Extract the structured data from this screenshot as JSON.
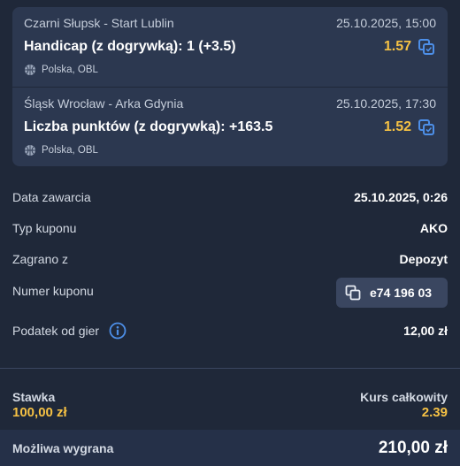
{
  "bets": [
    {
      "match": "Czarni Słupsk - Start Lublin",
      "datetime": "25.10.2025, 15:00",
      "market": "Handicap (z dogrywką): 1 (+3.5)",
      "odd": "1.57",
      "league": "Polska, OBL"
    },
    {
      "match": "Śląsk Wrocław - Arka Gdynia",
      "datetime": "25.10.2025, 17:30",
      "market": "Liczba punktów (z dogrywką): +163.5",
      "odd": "1.52",
      "league": "Polska, OBL"
    }
  ],
  "details": {
    "date_label": "Data zawarcia",
    "date_value": "25.10.2025, 0:26",
    "type_label": "Typ kuponu",
    "type_value": "AKO",
    "played_label": "Zagrano z",
    "played_value": "Depozyt",
    "coupon_label": "Numer kuponu",
    "coupon_value": "e74 196 03",
    "tax_label": "Podatek od gier",
    "tax_value": "12,00 zł"
  },
  "summary": {
    "stake_label": "Stawka",
    "stake_value": "100,00 zł",
    "total_odds_label": "Kurs całkowity",
    "total_odds_value": "2.39",
    "possible_win_label": "Możliwa wygrana",
    "possible_win_value": "210,00 zł"
  },
  "icons": {
    "copy": "copy-icon",
    "basketball": "basketball-icon",
    "info": "info-icon"
  },
  "colors": {
    "background": "#1f2839",
    "card": "#2c3850",
    "odds_accent": "#f5c144",
    "icon_blue": "#4d8fe8"
  }
}
